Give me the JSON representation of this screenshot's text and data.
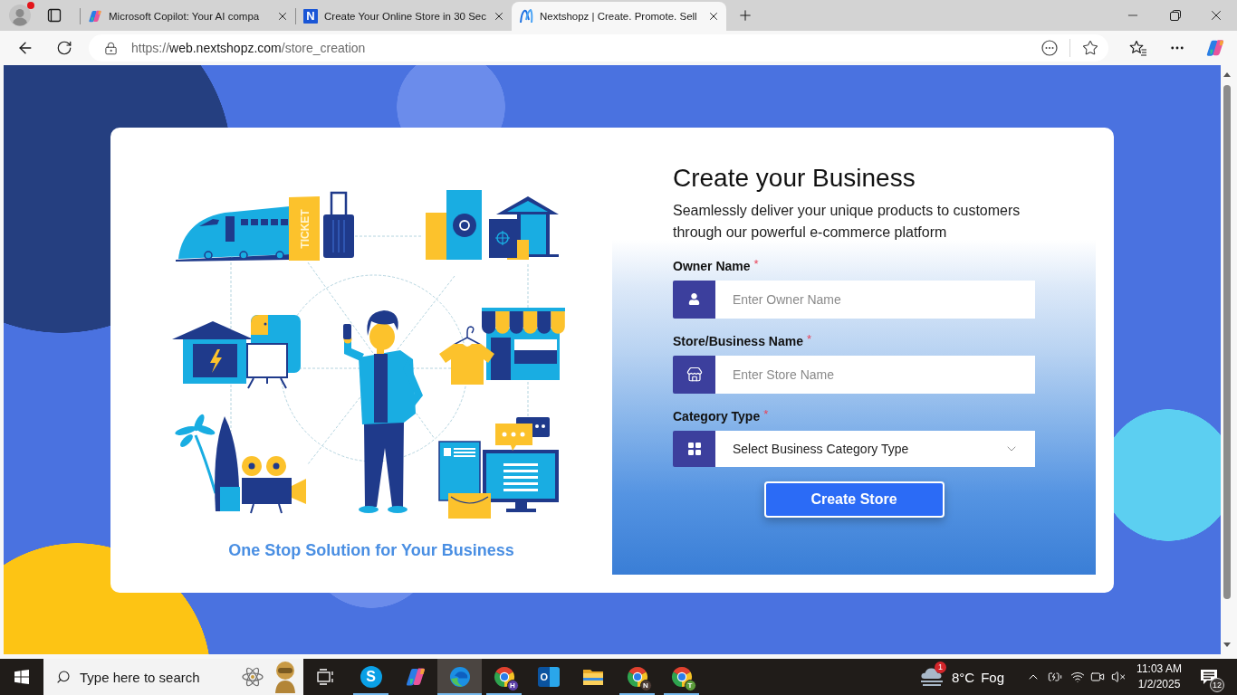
{
  "browser": {
    "profile": {
      "notification": true
    },
    "tabs": [
      {
        "title": "Microsoft Copilot: Your AI compa",
        "selected": false
      },
      {
        "title": "Create Your Online Store in 30 Sec",
        "icon_letter": "N",
        "selected": false
      },
      {
        "title": "Nextshopz | Create. Promote. Sell",
        "selected": true
      }
    ],
    "address": {
      "scheme": "https://",
      "domain": "web.nextshopz.com",
      "path": "/store_creation"
    }
  },
  "illustration": {
    "ticket_label": "TICKET",
    "tagline": "One Stop Solution for Your Business"
  },
  "form": {
    "title": "Create your Business",
    "subtitle": "Seamlessly deliver your unique products to customers through our powerful e-commerce platform",
    "fields": [
      {
        "kind": "text",
        "label": "Owner Name",
        "required_mark": "*",
        "placeholder": "Enter Owner Name"
      },
      {
        "kind": "text",
        "label": "Store/Business Name",
        "required_mark": "*",
        "placeholder": "Enter Store Name"
      },
      {
        "kind": "select",
        "label": "Category Type",
        "required_mark": "*",
        "value": "Select Business Category Type"
      }
    ],
    "submit": "Create Store"
  },
  "taskbar": {
    "search": {
      "placeholder": "Type here to search"
    },
    "apps": [
      {
        "kind": "task_view",
        "running": false,
        "active": false
      },
      {
        "kind": "chat",
        "letter": "S",
        "running": true,
        "active": false
      },
      {
        "kind": "assistant",
        "running": false,
        "active": false
      },
      {
        "kind": "wave_browser",
        "running": true,
        "active": true
      },
      {
        "kind": "ring_browser",
        "letter": "H",
        "color": "#5b3fa6",
        "running": true,
        "active": false
      },
      {
        "kind": "mail",
        "letter": "O",
        "running": false,
        "active": false
      },
      {
        "kind": "folder",
        "running": false,
        "active": false
      },
      {
        "kind": "ring_browser",
        "letter": "N",
        "color": "#4b3b35",
        "running": true,
        "active": false
      },
      {
        "kind": "ring_browser",
        "letter": "T",
        "color": "#5c9c3b",
        "running": true,
        "active": false
      }
    ],
    "weather": {
      "alert_count": "1",
      "temperature": "8°C",
      "condition": "Fog"
    },
    "clock": {
      "time": "11:03 AM",
      "date": "1/2/2025"
    },
    "notifications": {
      "count": "12"
    }
  }
}
